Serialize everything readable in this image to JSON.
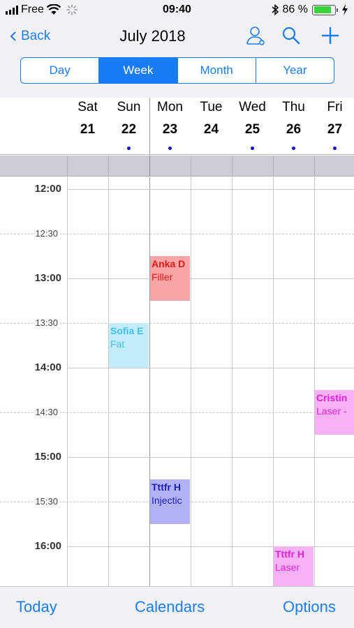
{
  "status": {
    "carrier": "Free",
    "time": "09:40",
    "battery": "86 %",
    "battery_level": 0.86,
    "icons": [
      "signal-icon",
      "wifi-icon",
      "activity-spinner-icon",
      "bluetooth-icon",
      "battery-icon",
      "charging-bolt-icon"
    ]
  },
  "nav": {
    "back_label": "Back",
    "title": "July 2018",
    "icons": [
      "contact-icon",
      "search-icon",
      "add-icon"
    ],
    "accent": "#1a7cf5"
  },
  "segments": [
    {
      "label": "Day",
      "active": false
    },
    {
      "label": "Week",
      "active": true
    },
    {
      "label": "Month",
      "active": false
    },
    {
      "label": "Year",
      "active": false
    }
  ],
  "days": [
    {
      "name": "Sat",
      "num": "21",
      "dot": false
    },
    {
      "name": "Sun",
      "num": "22",
      "dot": true
    },
    {
      "name": "Mon",
      "num": "23",
      "dot": true
    },
    {
      "name": "Tue",
      "num": "24",
      "dot": false
    },
    {
      "name": "Wed",
      "num": "25",
      "dot": true
    },
    {
      "name": "Thu",
      "num": "26",
      "dot": true
    },
    {
      "name": "Fri",
      "num": "27",
      "dot": true
    }
  ],
  "times": {
    "hours": [
      "12:00",
      "13:00",
      "14:00",
      "15:00",
      "16:00"
    ],
    "halves": [
      "12:30",
      "13:30",
      "14:30",
      "15:30"
    ]
  },
  "events": [
    {
      "name": "Anka D",
      "type": "Filler",
      "day": "Mon",
      "start": "12:45",
      "end": "13:15",
      "bg": "#f9a5a5",
      "color": "#e01818"
    },
    {
      "name": "Sofia E",
      "type": "Fat",
      "day": "Sun",
      "start": "13:30",
      "end": "14:00",
      "bg": "#c3ecfb",
      "color": "#3cc2ef"
    },
    {
      "name": "Cristin",
      "type": "Laser -",
      "day": "Fri",
      "start": "14:15",
      "end": "14:45",
      "bg": "#f7b2f5",
      "color": "#e020dc"
    },
    {
      "name": "Tttfr H",
      "type": "Injectic",
      "day": "Mon",
      "start": "15:15",
      "end": "15:45",
      "bg": "#b2b2f7",
      "color": "#1c1cc4"
    },
    {
      "name": "Tttfr H",
      "type": "Laser",
      "day": "Thu",
      "start": "16:00",
      "end": "16:30",
      "bg": "#f7b2f5",
      "color": "#e020dc"
    }
  ],
  "tabs": {
    "today": "Today",
    "calendars": "Calendars",
    "options": "Options"
  }
}
